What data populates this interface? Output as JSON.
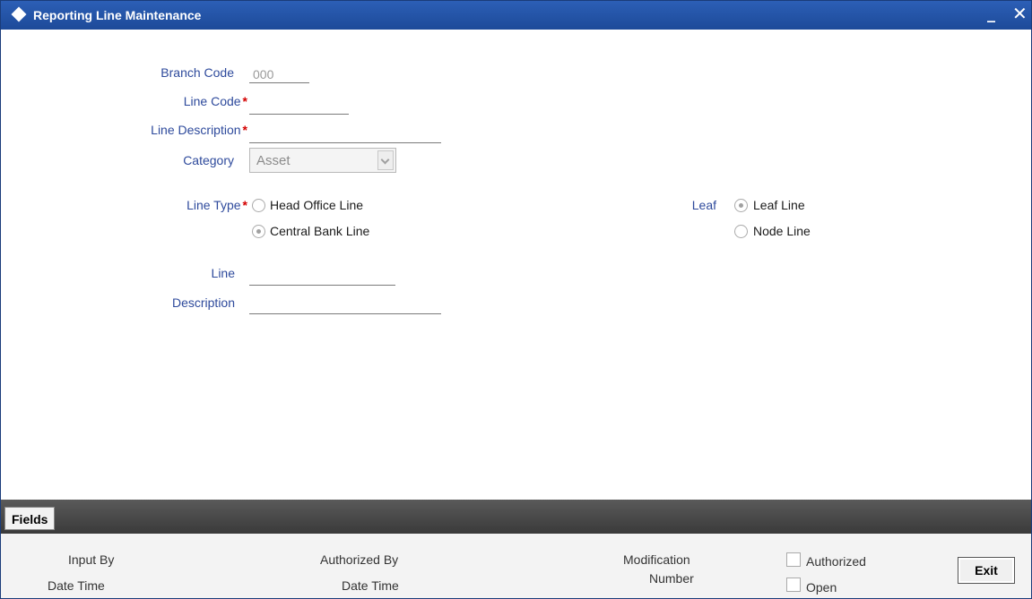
{
  "window": {
    "title": "Reporting Line Maintenance",
    "minimize_glyph": "_",
    "close_glyph": "✕"
  },
  "form": {
    "branch_code": {
      "label": "Branch Code",
      "value": "000"
    },
    "line_code": {
      "label": "Line Code",
      "required_mark": "*",
      "value": ""
    },
    "line_description": {
      "label": "Line Description",
      "required_mark": "*",
      "value": ""
    },
    "category": {
      "label": "Category",
      "selected": "Asset"
    },
    "line_type": {
      "label": "Line Type",
      "required_mark": "*",
      "options": [
        {
          "label": "Head Office Line",
          "checked": false
        },
        {
          "label": "Central Bank Line",
          "checked": true
        }
      ]
    },
    "leaf": {
      "label": "Leaf",
      "options": [
        {
          "label": "Leaf Line",
          "checked": true
        },
        {
          "label": "Node Line",
          "checked": false
        }
      ]
    },
    "line": {
      "label": "Line",
      "value": ""
    },
    "description": {
      "label": "Description",
      "value": ""
    }
  },
  "toolbar": {
    "fields_tab": "Fields"
  },
  "footer": {
    "input_by": "Input By",
    "date_time_1": "Date Time",
    "authorized_by": "Authorized By",
    "date_time_2": "Date Time",
    "modification": "Modification",
    "number": "Number",
    "authorized_label": "Authorized",
    "open_label": "Open",
    "exit_label": "Exit"
  },
  "colors": {
    "titlebar": "#1d4a99",
    "label": "#2e4a9c",
    "required": "#d40000"
  }
}
